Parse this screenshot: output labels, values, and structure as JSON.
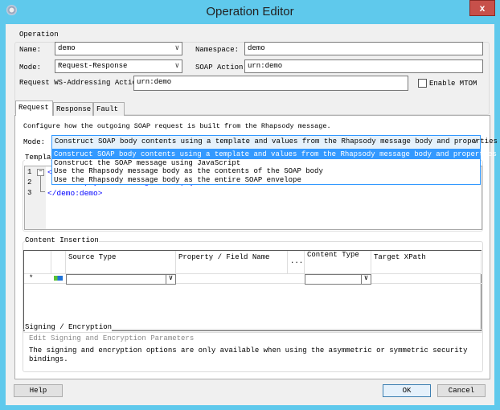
{
  "window": {
    "title": "Operation Editor",
    "close_label": "x"
  },
  "operation": {
    "group_label": "Operation",
    "name_label": "Name:",
    "name_value": "demo",
    "namespace_label": "Namespace:",
    "namespace_value": "demo",
    "mode_label": "Mode:",
    "mode_value": "Request-Response",
    "soap_action_label": "SOAP Action:",
    "soap_action_value": "urn:demo",
    "ws_addressing_label": "Request WS-Addressing Action",
    "ws_addressing_value": "urn:demo",
    "mtom_label": "Enable MTOM",
    "mtom_checked": false
  },
  "tabs": [
    {
      "label": "Request",
      "selected": true
    },
    {
      "label": "Response"
    },
    {
      "label": "Fault"
    }
  ],
  "request": {
    "description": "Configure how the outgoing SOAP request is built from the Rhapsody message.",
    "mode_label": "Mode:",
    "mode_value": "Construct SOAP body contents using a template and values from the Rhapsody message body and properties",
    "mode_options": [
      "Construct SOAP body contents using a template and values from the Rhapsody message body and properties",
      "Construct the SOAP message using JavaScript",
      "Use the Rhapsody message body as the contents of the SOAP body",
      "Use the Rhapsody message body as the entire SOAP envelope"
    ],
    "template_label": "Templa",
    "code_lines": [
      {
        "n": "1",
        "text": "<"
      },
      {
        "n": "2",
        "text": "<demo:payload>String</demo:payload>"
      },
      {
        "n": "3",
        "text": "</demo:demo>"
      }
    ]
  },
  "content_insertion": {
    "group_label": "Content Insertion",
    "columns": [
      "",
      "",
      "Source Type",
      "Property / Field Name",
      "...",
      "Content Type",
      "Target XPath"
    ],
    "new_row_marker": "*"
  },
  "signing": {
    "group_label": "Signing / Encryption",
    "link": "Edit Signing and Encryption Parameters",
    "note": "The signing and encryption options are only available when using the asymmetric or symmetric security",
    "note2": "bindings."
  },
  "buttons": {
    "help": "Help",
    "ok": "OK",
    "cancel": "Cancel"
  },
  "colors": {
    "titlebar": "#5fc9ec",
    "selection": "#3399ff",
    "close": "#c7504a"
  }
}
